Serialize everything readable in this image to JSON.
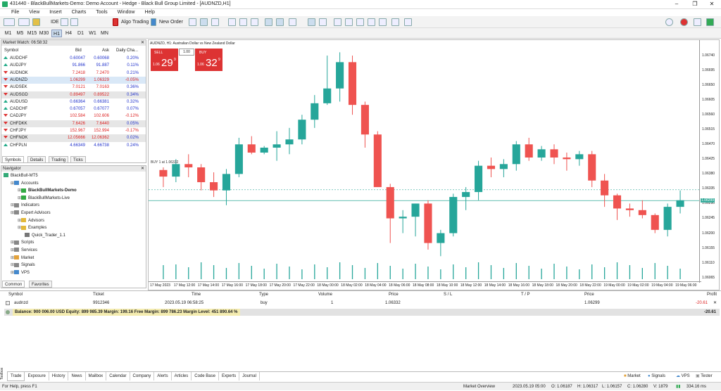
{
  "window": {
    "title": "431440 - BlackBullMarkets-Demo: Demo Account - Hedge - Black Bull Group Limited - [AUDNZD,H1]"
  },
  "menu": [
    "File",
    "View",
    "Insert",
    "Charts",
    "Tools",
    "Window",
    "Help"
  ],
  "toolbar": {
    "ide": "IDE",
    "algo": "Algo Trading",
    "neworder": "New Order"
  },
  "timeframes": [
    "M1",
    "M5",
    "M15",
    "M30",
    "H1",
    "H4",
    "D1",
    "W1",
    "MN"
  ],
  "active_tf": "H1",
  "market_watch": {
    "title": "Market Watch: 06:58:32",
    "headers": [
      "Symbol",
      "Bid",
      "Ask",
      "Daily Cha..."
    ],
    "rows": [
      {
        "s": "AUDCHF",
        "bid": "0.60047",
        "ask": "0.60068",
        "chg": "0.20%",
        "bc": "#23c",
        "cc": "#23c",
        "dir": "up"
      },
      {
        "s": "AUDJPY",
        "bid": "91.866",
        "ask": "91.887",
        "chg": "0.11%",
        "bc": "#23c",
        "cc": "#23c",
        "dir": "up"
      },
      {
        "s": "AUDNOK",
        "bid": "7.2418",
        "ask": "7.2470",
        "chg": "0.21%",
        "bc": "#d22",
        "cc": "#23c",
        "dir": "dn"
      },
      {
        "s": "AUDNZD",
        "bid": "1.06299",
        "ask": "1.06329",
        "chg": "-0.05%",
        "bc": "#d22",
        "cc": "#d22",
        "dir": "dn"
      },
      {
        "s": "AUDSEK",
        "bid": "7.0121",
        "ask": "7.0163",
        "chg": "0.36%",
        "bc": "#d22",
        "cc": "#23c",
        "dir": "dn"
      },
      {
        "s": "AUDSGD",
        "bid": "0.89497",
        "ask": "0.89522",
        "chg": "0.34%",
        "bc": "#d22",
        "cc": "#23c",
        "dir": "dn"
      },
      {
        "s": "AUDUSD",
        "bid": "0.66364",
        "ask": "0.66381",
        "chg": "0.32%",
        "bc": "#23c",
        "cc": "#23c",
        "dir": "up"
      },
      {
        "s": "CADCHF",
        "bid": "0.67057",
        "ask": "0.67077",
        "chg": "0.07%",
        "bc": "#23c",
        "cc": "#23c",
        "dir": "up"
      },
      {
        "s": "CADJPY",
        "bid": "102.584",
        "ask": "102.606",
        "chg": "-0.12%",
        "bc": "#d22",
        "cc": "#d22",
        "dir": "dn"
      },
      {
        "s": "CHFDKK",
        "bid": "7.6426",
        "ask": "7.6440",
        "chg": "0.05%",
        "bc": "#d22",
        "cc": "#23c",
        "dir": "dn"
      },
      {
        "s": "CHFJPY",
        "bid": "152.967",
        "ask": "152.994",
        "chg": "-0.17%",
        "bc": "#d22",
        "cc": "#d22",
        "dir": "dn"
      },
      {
        "s": "CHFNOK",
        "bid": "12.05666",
        "ask": "12.06362",
        "chg": "0.02%",
        "bc": "#d22",
        "cc": "#23c",
        "dir": "dn"
      },
      {
        "s": "CHFPLN",
        "bid": "4.66349",
        "ask": "4.66738",
        "chg": "0.24%",
        "bc": "#23c",
        "cc": "#23c",
        "dir": "up"
      }
    ],
    "tabs": [
      "Symbols",
      "Details",
      "Trading",
      "Ticks"
    ]
  },
  "navigator": {
    "title": "Navigator",
    "items": [
      {
        "label": "BlackBull-MT5",
        "lvl": 0,
        "bold": false,
        "ico": "#3a7"
      },
      {
        "label": "Accounts",
        "lvl": 1,
        "bold": false,
        "ico": "#48c"
      },
      {
        "label": "BlackBullMarkets-Demo",
        "lvl": 2,
        "bold": true,
        "ico": "#3a4"
      },
      {
        "label": "BlackBullMarkets-Live",
        "lvl": 2,
        "bold": false,
        "ico": "#3a4"
      },
      {
        "label": "Indicators",
        "lvl": 1,
        "bold": false,
        "ico": "#888"
      },
      {
        "label": "Expert Advisors",
        "lvl": 1,
        "bold": false,
        "ico": "#888"
      },
      {
        "label": "Advisors",
        "lvl": 2,
        "bold": false,
        "ico": "#e3b93b"
      },
      {
        "label": "Examples",
        "lvl": 2,
        "bold": false,
        "ico": "#e3b93b"
      },
      {
        "label": "Quick_Trader_1.1",
        "lvl": 3,
        "bold": false,
        "ico": "#777"
      },
      {
        "label": "Scripts",
        "lvl": 1,
        "bold": false,
        "ico": "#888"
      },
      {
        "label": "Services",
        "lvl": 1,
        "bold": false,
        "ico": "#888"
      },
      {
        "label": "Market",
        "lvl": 1,
        "bold": false,
        "ico": "#e3a23b"
      },
      {
        "label": "Signals",
        "lvl": 1,
        "bold": false,
        "ico": "#888"
      },
      {
        "label": "VPS",
        "lvl": 1,
        "bold": false,
        "ico": "#48c"
      }
    ],
    "tabs": [
      "Common",
      "Favorites"
    ]
  },
  "chart": {
    "title": "AUDNZD, H1:  Australian Dollar vs New Zealand Dollar",
    "sell": "SELL",
    "buy": "BUY",
    "lot": "1.00",
    "sell_big": "1.06",
    "sell_pts": "29",
    "sell_sup": "9",
    "buy_big": "1.06",
    "buy_pts": "32",
    "buy_sup": "9",
    "order_line_label": "BUY 1 at 1.06332",
    "bid_label": "1.06299",
    "y_ticks": [
      "1.06740",
      "1.06695",
      "1.06650",
      "1.06605",
      "1.06560",
      "1.06515",
      "1.06470",
      "1.06425",
      "1.06380",
      "1.06335",
      "1.06290",
      "1.06245",
      "1.06200",
      "1.06155",
      "1.06110",
      "1.06065"
    ],
    "x_ticks": [
      "17 May 2023",
      "17 May 12:00",
      "17 May 14:00",
      "17 May 16:00",
      "17 May 18:00",
      "17 May 20:00",
      "17 May 22:00",
      "18 May 00:00",
      "18 May 02:00",
      "18 May 04:00",
      "18 May 06:00",
      "18 May 08:00",
      "18 May 10:00",
      "18 May 12:00",
      "18 May 14:00",
      "18 May 16:00",
      "18 May 18:00",
      "18 May 20:00",
      "18 May 22:00",
      "19 May 00:00",
      "19 May 02:00",
      "19 May 04:00",
      "19 May 06:00"
    ]
  },
  "chart_data": {
    "type": "candlestick",
    "symbol": "AUDNZD",
    "timeframe": "H1",
    "ylim": [
      1.0606,
      1.0677
    ],
    "candles": [
      [
        1.06392,
        1.064,
        1.0634,
        1.06372
      ],
      [
        1.06372,
        1.06425,
        1.06355,
        1.0641
      ],
      [
        1.0641,
        1.0644,
        1.0637,
        1.064
      ],
      [
        1.064,
        1.0641,
        1.0633,
        1.06355
      ],
      [
        1.06355,
        1.06385,
        1.0631,
        1.0633
      ],
      [
        1.0633,
        1.06395,
        1.06285,
        1.0638
      ],
      [
        1.0638,
        1.0649,
        1.0637,
        1.0647
      ],
      [
        1.0647,
        1.06495,
        1.0644,
        1.06445
      ],
      [
        1.06445,
        1.06465,
        1.0644,
        1.0646
      ],
      [
        1.0646,
        1.0651,
        1.0642,
        1.0647
      ],
      [
        1.0647,
        1.0652,
        1.0644,
        1.06485
      ],
      [
        1.06485,
        1.0656,
        1.0647,
        1.06545
      ],
      [
        1.06545,
        1.0662,
        1.0652,
        1.06595
      ],
      [
        1.06595,
        1.0674,
        1.0659,
        1.0664
      ],
      [
        1.0664,
        1.0675,
        1.066,
        1.0672
      ],
      [
        1.0672,
        1.0674,
        1.0656,
        1.0659
      ],
      [
        1.0659,
        1.066,
        1.0646,
        1.065
      ],
      [
        1.065,
        1.0651,
        1.0638,
        1.0634
      ],
      [
        1.0634,
        1.0635,
        1.0617,
        1.06245
      ],
      [
        1.06245,
        1.0627,
        1.062,
        1.0625
      ],
      [
        1.0625,
        1.0629,
        1.0619,
        1.0629
      ],
      [
        1.0629,
        1.063,
        1.0615,
        1.0617
      ],
      [
        1.0617,
        1.0621,
        1.0613,
        1.062
      ],
      [
        1.062,
        1.0632,
        1.0619,
        1.0631
      ],
      [
        1.0631,
        1.0634,
        1.0627,
        1.06325
      ],
      [
        1.06325,
        1.0642,
        1.063,
        1.06405
      ],
      [
        1.06405,
        1.0643,
        1.0637,
        1.06395
      ],
      [
        1.06395,
        1.06425,
        1.0637,
        1.0641
      ],
      [
        1.0641,
        1.0648,
        1.0639,
        1.0647
      ],
      [
        1.0647,
        1.0649,
        1.0642,
        1.0643
      ],
      [
        1.0643,
        1.06465,
        1.0642,
        1.06455
      ],
      [
        1.06455,
        1.0647,
        1.0641,
        1.0643
      ],
      [
        1.0643,
        1.06445,
        1.0639,
        1.06425
      ],
      [
        1.06425,
        1.0645,
        1.06405,
        1.0644
      ],
      [
        1.0644,
        1.0645,
        1.0634,
        1.0636
      ],
      [
        1.0636,
        1.0638,
        1.0628,
        1.06315
      ],
      [
        1.06315,
        1.0632,
        1.0624,
        1.06275
      ],
      [
        1.06275,
        1.0629,
        1.0625,
        1.0627
      ],
      [
        1.0627,
        1.063,
        1.06245,
        1.06255
      ],
      [
        1.06255,
        1.0626,
        1.062,
        1.0621
      ],
      [
        1.0621,
        1.0629,
        1.0619,
        1.0628
      ],
      [
        1.0628,
        1.0633,
        1.0626,
        1.063
      ]
    ],
    "levels": {
      "order": 1.06332,
      "bid": 1.06299
    }
  },
  "terminal": {
    "headers": [
      "Symbol",
      "Ticket",
      "Time",
      "Type",
      "Volume",
      "Price",
      "S / L",
      "T / P",
      "Price",
      "Profit"
    ],
    "row": {
      "symbol": "audnzd",
      "ticket": "9912346",
      "time": "2023.05.19 06:58:25",
      "type": "buy",
      "volume": "1",
      "price": "1.06332",
      "sl": "",
      "tp": "",
      "cur": "1.06299",
      "profit": "-20.61"
    },
    "balance": "Balance: 900 006.00 USD  Equity: 899 985.39  Margin: 199.16  Free Margin: 899 786.23  Margin Level: 451 890.64 %",
    "total": "-20.61",
    "tabs": [
      "Trade",
      "Exposure",
      "History",
      "News",
      "Mailbox",
      "Calendar",
      "Company",
      "Alerts",
      "Articles",
      "Code Base",
      "Experts",
      "Journal"
    ],
    "right_tabs": [
      "Market",
      "Signals",
      "VPS",
      "Tester"
    ],
    "toolbox": "Toolbox"
  },
  "status": {
    "help": "For Help, press F1",
    "profile": "Market Overview",
    "time": "2023.05.19 05:00",
    "o": "O: 1.06187",
    "h": "H: 1.06317",
    "l": "L: 1.06157",
    "c": "C: 1.06280",
    "v": "V: 1879",
    "ping": "334.16 ms"
  }
}
